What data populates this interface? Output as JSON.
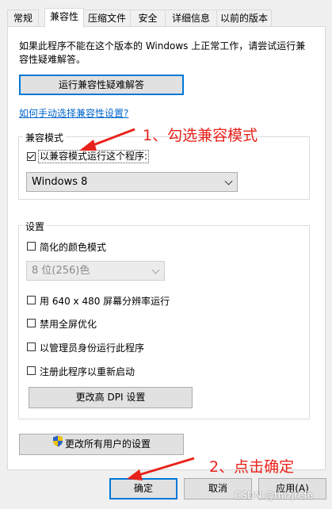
{
  "tabs": [
    {
      "label": "常规",
      "active": false
    },
    {
      "label": "兼容性",
      "active": true
    },
    {
      "label": "压缩文件",
      "active": false
    },
    {
      "label": "安全",
      "active": false
    },
    {
      "label": "详细信息",
      "active": false
    },
    {
      "label": "以前的版本",
      "active": false
    }
  ],
  "intro_text": "如果此程序不能在这个版本的 Windows 上正常工作，请尝试运行兼容性疑难解答。",
  "troubleshooter_button": "运行兼容性疑难解答",
  "manual_link": "如何手动选择兼容性设置?",
  "compat_mode": {
    "legend": "兼容模式",
    "checkbox_label": "以兼容模式运行这个程序:",
    "checked": true,
    "selected_os": "Windows 8"
  },
  "settings": {
    "legend": "设置",
    "reduced_color_label": "简化的颜色模式",
    "reduced_color_checked": false,
    "color_select": "8 位(256)色",
    "res_640_label": "用 640 x 480 屏幕分辨率运行",
    "res_640_checked": false,
    "disable_fullscreen_label": "禁用全屏优化",
    "disable_fullscreen_checked": false,
    "run_as_admin_label": "以管理员身份运行此程序",
    "run_as_admin_checked": false,
    "register_restart_label": "注册此程序以重新启动",
    "register_restart_checked": false,
    "dpi_button": "更改高 DPI 设置"
  },
  "all_users_button": "更改所有用户的设置",
  "footer": {
    "ok": "确定",
    "cancel": "取消",
    "apply": "应用(A)"
  },
  "annotations": {
    "step1": "1、勾选兼容模式",
    "step2": "2、点击确定",
    "color": "#e8231b"
  },
  "watermark": "CSDN @thizjrefe"
}
